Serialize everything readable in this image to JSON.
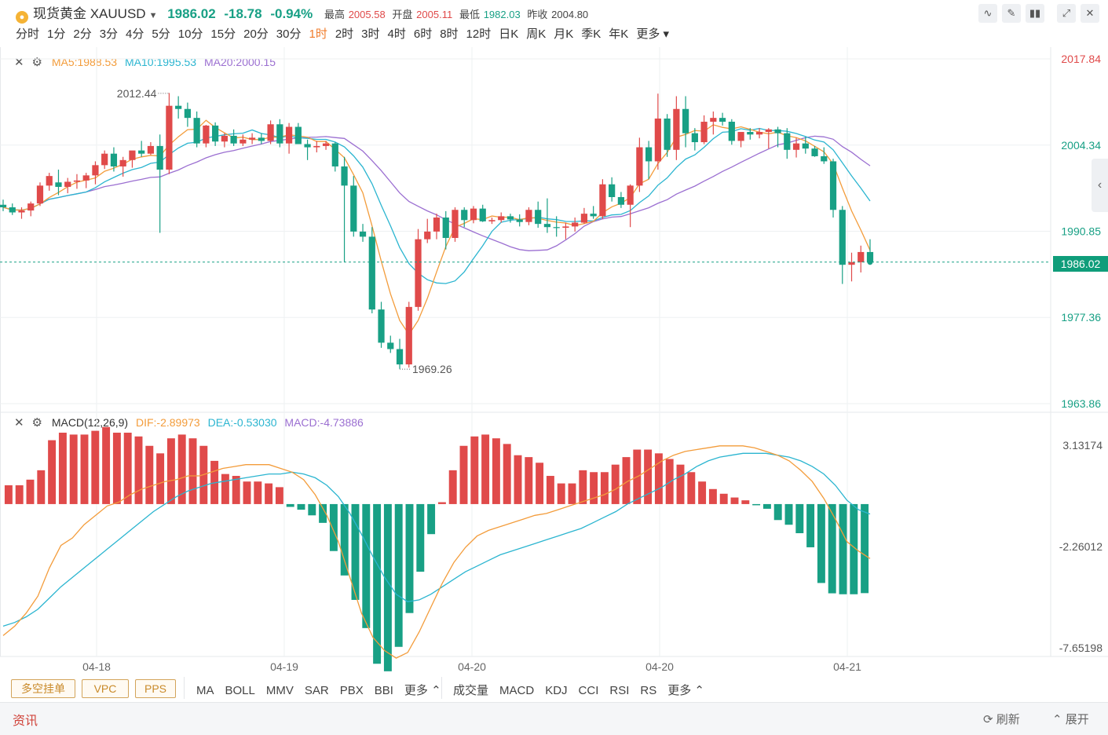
{
  "header": {
    "instrument": "现货黄金 XAUUSD",
    "price": "1986.02",
    "change": "-18.78",
    "change_pct": "-0.94%",
    "high_label": "最高",
    "high": "2005.58",
    "open_label": "开盘",
    "open": "2005.11",
    "low_label": "最低",
    "low": "1982.03",
    "prev_close_label": "昨收",
    "prev_close": "2004.80"
  },
  "timeframes": [
    "分时",
    "1分",
    "2分",
    "3分",
    "4分",
    "5分",
    "10分",
    "15分",
    "20分",
    "30分",
    "1时",
    "2时",
    "3时",
    "4时",
    "6时",
    "8时",
    "12时",
    "日K",
    "周K",
    "月K",
    "季K",
    "年K",
    "更多"
  ],
  "active_timeframe": "1时",
  "main_legend": {
    "ma5": "MA5:1988.53",
    "ma10": "MA10:1995.53",
    "ma20": "MA20:2000.15"
  },
  "macd_legend": {
    "name": "MACD(12,26,9)",
    "dif": "DIF:-2.89973",
    "dea": "DEA:-0.53030",
    "macd": "MACD:-4.73886"
  },
  "price_axis": [
    "2017.84",
    "2004.34",
    "1990.85",
    "1977.36",
    "1963.86"
  ],
  "current_price_tag": "1986.02",
  "macd_axis": [
    "3.13174",
    "-2.26012",
    "-7.65198"
  ],
  "x_labels": [
    "04-18",
    "04-19",
    "04-20",
    "04-20",
    "04-21"
  ],
  "annotations": {
    "high": "2012.44",
    "low": "1969.26"
  },
  "indicator_buttons": [
    "多空挂单",
    "VPC",
    "PPS"
  ],
  "main_indicators": [
    "MA",
    "BOLL",
    "MMV",
    "SAR",
    "PBX",
    "BBI",
    "更多"
  ],
  "sub_indicators": [
    "成交量",
    "MACD",
    "KDJ",
    "CCI",
    "RSI",
    "RS",
    "更多"
  ],
  "footer": {
    "news": "资讯",
    "refresh": "刷新",
    "expand": "展开"
  },
  "colors": {
    "up": "#e04a4a",
    "down": "#18a085",
    "ma5": "#f39c3b",
    "ma10": "#2bb5d0",
    "ma20": "#9b6fd1"
  },
  "chart_data": [
    {
      "type": "candlestick",
      "title": "",
      "x_ticks": [
        "04-18",
        "04-19",
        "04-20",
        "04-20",
        "04-21"
      ],
      "y_ticks": [
        2017.84,
        2004.34,
        1990.85,
        1977.36,
        1963.86
      ],
      "ohlc": [
        [
          1995.0,
          1995.8,
          1994.0,
          1994.6
        ],
        [
          1994.6,
          1995.2,
          1993.4,
          1993.8
        ],
        [
          1993.8,
          1994.6,
          1992.8,
          1994.1
        ],
        [
          1994.1,
          1995.5,
          1993.2,
          1995.2
        ],
        [
          1995.2,
          1998.5,
          1994.8,
          1998.0
        ],
        [
          1998.0,
          2000.0,
          1997.2,
          1999.5
        ],
        [
          1998.5,
          2000.5,
          1996.5,
          1997.8
        ],
        [
          1997.8,
          1999.2,
          1996.8,
          1998.6
        ],
        [
          1998.6,
          1999.8,
          1997.5,
          1998.8
        ],
        [
          1998.8,
          2000.0,
          1997.6,
          1999.6
        ],
        [
          1999.6,
          2001.8,
          1998.2,
          2001.2
        ],
        [
          2001.2,
          2003.5,
          2000.6,
          2003.0
        ],
        [
          2003.0,
          2004.0,
          2000.2,
          2001.0
        ],
        [
          2001.0,
          2002.5,
          1999.4,
          2002.0
        ],
        [
          2002.0,
          2003.2,
          2000.8,
          2003.5
        ],
        [
          2003.5,
          2005.0,
          2002.5,
          2003.0
        ],
        [
          2003.0,
          2004.8,
          2002.8,
          2004.2
        ],
        [
          2004.2,
          2006.0,
          1990.6,
          2000.5
        ],
        [
          2000.5,
          2012.5,
          1999.8,
          2010.5
        ],
        [
          2010.5,
          2012.0,
          2008.5,
          2010.0
        ],
        [
          2010.0,
          2011.0,
          2007.2,
          2008.6
        ],
        [
          2008.6,
          2009.6,
          2004.0,
          2004.6
        ],
        [
          2004.6,
          2007.5,
          2004.0,
          2007.4
        ],
        [
          2007.4,
          2007.9,
          2004.2,
          2004.9
        ],
        [
          2004.9,
          2006.2,
          2004.0,
          2005.8
        ],
        [
          2005.8,
          2006.8,
          2004.2,
          2004.6
        ],
        [
          2004.6,
          2006.0,
          2004.2,
          2005.2
        ],
        [
          2005.2,
          2006.2,
          2004.5,
          2005.5
        ],
        [
          2005.5,
          2006.2,
          2004.5,
          2005.0
        ],
        [
          2005.0,
          2008.2,
          2004.5,
          2007.6
        ],
        [
          2007.6,
          2008.4,
          2004.0,
          2004.6
        ],
        [
          2004.6,
          2007.8,
          2003.0,
          2007.2
        ],
        [
          2007.2,
          2007.8,
          2004.5,
          2004.5
        ],
        [
          2004.5,
          2005.2,
          2002.0,
          2004.0
        ],
        [
          2004.0,
          2005.0,
          2003.2,
          2004.2
        ],
        [
          2004.2,
          2005.0,
          2003.6,
          2004.6
        ],
        [
          2004.6,
          2004.8,
          2000.2,
          2001.0
        ],
        [
          2001.0,
          2002.5,
          1986.0,
          1998.0
        ],
        [
          1998.0,
          1999.5,
          1990.0,
          1990.8
        ],
        [
          1990.8,
          1992.0,
          1989.2,
          1990.0
        ],
        [
          1990.0,
          1991.5,
          1978.0,
          1978.6
        ],
        [
          1978.6,
          1979.8,
          1972.6,
          1973.4
        ],
        [
          1973.4,
          1974.5,
          1971.8,
          1972.4
        ],
        [
          1972.4,
          1974.0,
          1969.3,
          1970.0
        ],
        [
          1970.0,
          1979.8,
          1969.5,
          1979.0
        ],
        [
          1979.0,
          1991.2,
          1978.4,
          1989.6
        ],
        [
          1989.6,
          1992.8,
          1989.0,
          1990.8
        ],
        [
          1990.8,
          1993.6,
          1989.6,
          1993.0
        ],
        [
          1993.0,
          1994.0,
          1988.0,
          1989.8
        ],
        [
          1989.8,
          1994.6,
          1989.2,
          1994.2
        ],
        [
          1994.2,
          1994.6,
          1991.5,
          1992.6
        ],
        [
          1992.6,
          1994.8,
          1992.1,
          1994.4
        ],
        [
          1994.4,
          1995.0,
          1992.3,
          1992.4
        ],
        [
          1992.4,
          1993.0,
          1992.0,
          1992.6
        ],
        [
          1992.6,
          1993.8,
          1992.2,
          1993.2
        ],
        [
          1993.2,
          1993.6,
          1992.2,
          1992.7
        ],
        [
          1992.7,
          1993.5,
          1991.6,
          1992.3
        ],
        [
          1992.3,
          1994.6,
          1991.8,
          1994.2
        ],
        [
          1994.2,
          1995.5,
          1991.4,
          1992.0
        ],
        [
          1992.0,
          1996.0,
          1990.6,
          1991.5
        ],
        [
          1991.5,
          1993.2,
          1990.0,
          1991.4
        ],
        [
          1991.4,
          1992.2,
          1989.6,
          1991.6
        ],
        [
          1991.6,
          1993.0,
          1990.8,
          1992.2
        ],
        [
          1992.2,
          1994.5,
          1992.0,
          1993.6
        ],
        [
          1993.6,
          1994.8,
          1992.8,
          1993.2
        ],
        [
          1993.2,
          1999.0,
          1992.8,
          1998.2
        ],
        [
          1998.2,
          1999.3,
          1995.5,
          1996.2
        ],
        [
          1996.2,
          1997.0,
          1994.5,
          1995.0
        ],
        [
          1995.0,
          1998.2,
          1991.5,
          1998.0
        ],
        [
          1998.0,
          2005.5,
          1997.0,
          2004.0
        ],
        [
          2004.0,
          2005.0,
          1999.0,
          2001.8
        ],
        [
          2001.8,
          2012.4,
          2000.5,
          2008.5
        ],
        [
          2008.5,
          2009.2,
          2002.5,
          2003.6
        ],
        [
          2003.6,
          2012.0,
          2002.0,
          2010.0
        ],
        [
          2010.0,
          2012.0,
          2004.0,
          2006.2
        ],
        [
          2006.2,
          2007.0,
          2003.5,
          2004.8
        ],
        [
          2004.8,
          2009.0,
          2004.5,
          2008.0
        ],
        [
          2008.0,
          2009.6,
          2006.0,
          2008.6
        ],
        [
          2008.6,
          2009.4,
          2007.4,
          2008.0
        ],
        [
          2008.0,
          2008.4,
          2004.4,
          2005.0
        ],
        [
          2005.0,
          2006.2,
          2004.0,
          2006.4
        ],
        [
          2006.4,
          2007.0,
          2005.2,
          2006.0
        ],
        [
          2006.0,
          2007.0,
          2005.4,
          2006.4
        ],
        [
          2006.4,
          2007.0,
          2003.8,
          2006.8
        ],
        [
          2006.8,
          2007.2,
          2004.0,
          2006.2
        ],
        [
          2006.2,
          2007.0,
          2002.2,
          2003.6
        ],
        [
          2003.6,
          2005.5,
          2002.4,
          2004.6
        ],
        [
          2004.6,
          2005.6,
          2003.0,
          2003.8
        ],
        [
          2003.8,
          2004.2,
          2002.5,
          2002.6
        ],
        [
          2002.6,
          2004.0,
          2001.4,
          2001.8
        ],
        [
          2001.8,
          2002.2,
          1993.0,
          1994.2
        ],
        [
          1994.2,
          1994.8,
          1982.6,
          1985.6
        ],
        [
          1985.6,
          1987.5,
          1983.0,
          1986.0
        ],
        [
          1986.0,
          1988.6,
          1984.4,
          1987.6
        ],
        [
          1987.6,
          1989.6,
          1985.6,
          1986.0
        ]
      ],
      "ma_series": [
        {
          "name": "MA5",
          "last": 1988.53
        },
        {
          "name": "MA10",
          "last": 1995.53
        },
        {
          "name": "MA20",
          "last": 2000.15
        }
      ],
      "high_mark": 2012.44,
      "low_mark": 1969.26,
      "current_price": 1986.02
    },
    {
      "type": "bar",
      "title": "MACD(12,26,9)",
      "y_ticks": [
        3.13174,
        -2.26012,
        -7.65198
      ],
      "macd_hist": [
        1.0,
        1.0,
        1.3,
        1.8,
        3.4,
        3.8,
        3.7,
        3.7,
        3.9,
        4.1,
        3.8,
        3.8,
        3.6,
        3.1,
        2.7,
        3.5,
        3.7,
        3.5,
        3.1,
        2.3,
        1.6,
        1.5,
        1.2,
        1.2,
        1.1,
        0.9,
        -0.15,
        -0.3,
        -0.6,
        -1.0,
        -2.5,
        -3.8,
        -5.1,
        -6.6,
        -8.5,
        -8.9,
        -7.6,
        -5.8,
        -3.6,
        -1.6,
        0.1,
        1.8,
        3.1,
        3.6,
        3.7,
        3.5,
        3.2,
        2.6,
        2.5,
        2.2,
        1.5,
        1.1,
        1.1,
        1.8,
        1.7,
        1.7,
        2.1,
        2.5,
        2.9,
        2.9,
        2.7,
        2.4,
        2.1,
        1.7,
        1.2,
        0.8,
        0.55,
        0.35,
        0.2,
        -0.05,
        -0.25,
        -0.85,
        -1.1,
        -1.55,
        -2.3,
        -4.2,
        -4.75,
        -4.8,
        -4.8,
        -4.74
      ],
      "dif": [
        -7.0,
        -6.5,
        -5.8,
        -4.9,
        -3.4,
        -2.2,
        -1.8,
        -1.1,
        -0.6,
        -0.1,
        0.1,
        0.5,
        0.8,
        1.0,
        1.2,
        1.3,
        1.5,
        1.5,
        1.7,
        1.9,
        2.0,
        2.1,
        2.1,
        2.1,
        1.9,
        1.7,
        1.3,
        0.5,
        -0.6,
        -2.0,
        -3.9,
        -5.8,
        -7.1,
        -7.8,
        -8.2,
        -7.9,
        -6.8,
        -5.5,
        -4.2,
        -3.1,
        -2.3,
        -1.7,
        -1.4,
        -1.2,
        -1.0,
        -0.8,
        -0.6,
        -0.5,
        -0.3,
        -0.1,
        0.1,
        0.3,
        0.5,
        0.8,
        1.2,
        1.5,
        1.9,
        2.3,
        2.6,
        2.8,
        2.9,
        3.0,
        3.1,
        3.1,
        3.1,
        3.0,
        2.8,
        2.6,
        2.3,
        1.8,
        1.2,
        0.3,
        -0.8,
        -2.0,
        -2.5,
        -2.9
      ],
      "dea": [
        -6.5,
        -6.3,
        -6.0,
        -5.6,
        -5.0,
        -4.4,
        -3.9,
        -3.4,
        -2.9,
        -2.4,
        -1.9,
        -1.4,
        -0.9,
        -0.4,
        0.0,
        0.4,
        0.7,
        0.9,
        1.1,
        1.2,
        1.3,
        1.4,
        1.5,
        1.6,
        1.6,
        1.7,
        1.6,
        1.4,
        1.0,
        0.4,
        -0.5,
        -1.6,
        -2.8,
        -3.9,
        -4.8,
        -5.2,
        -5.1,
        -4.8,
        -4.4,
        -4.0,
        -3.6,
        -3.3,
        -3.0,
        -2.7,
        -2.5,
        -2.3,
        -2.1,
        -1.9,
        -1.7,
        -1.5,
        -1.3,
        -1.0,
        -0.7,
        -0.4,
        0.0,
        0.3,
        0.6,
        0.9,
        1.3,
        1.6,
        2.0,
        2.3,
        2.5,
        2.6,
        2.7,
        2.7,
        2.7,
        2.6,
        2.5,
        2.3,
        2.0,
        1.6,
        1.0,
        0.2,
        -0.3,
        -0.53
      ]
    }
  ]
}
